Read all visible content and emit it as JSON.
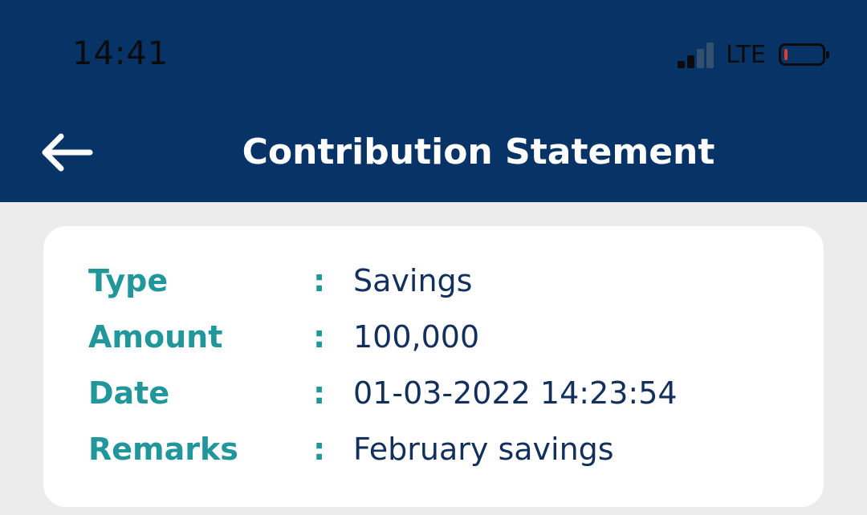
{
  "status_bar": {
    "time": "14:41",
    "network": "LTE"
  },
  "header": {
    "title": "Contribution Statement",
    "back_icon": "arrow-left-icon"
  },
  "statement": {
    "rows": [
      {
        "label": "Type",
        "separator": ":",
        "value": "Savings"
      },
      {
        "label": "Amount",
        "separator": ":",
        "value": "100,000"
      },
      {
        "label": "Date",
        "separator": ":",
        "value": "01-03-2022 14:23:54"
      },
      {
        "label": "Remarks",
        "separator": ":",
        "value": "February savings"
      }
    ]
  },
  "colors": {
    "header_bg": "#073366",
    "label": "#21969b",
    "value": "#13305c",
    "background": "#ececec"
  }
}
